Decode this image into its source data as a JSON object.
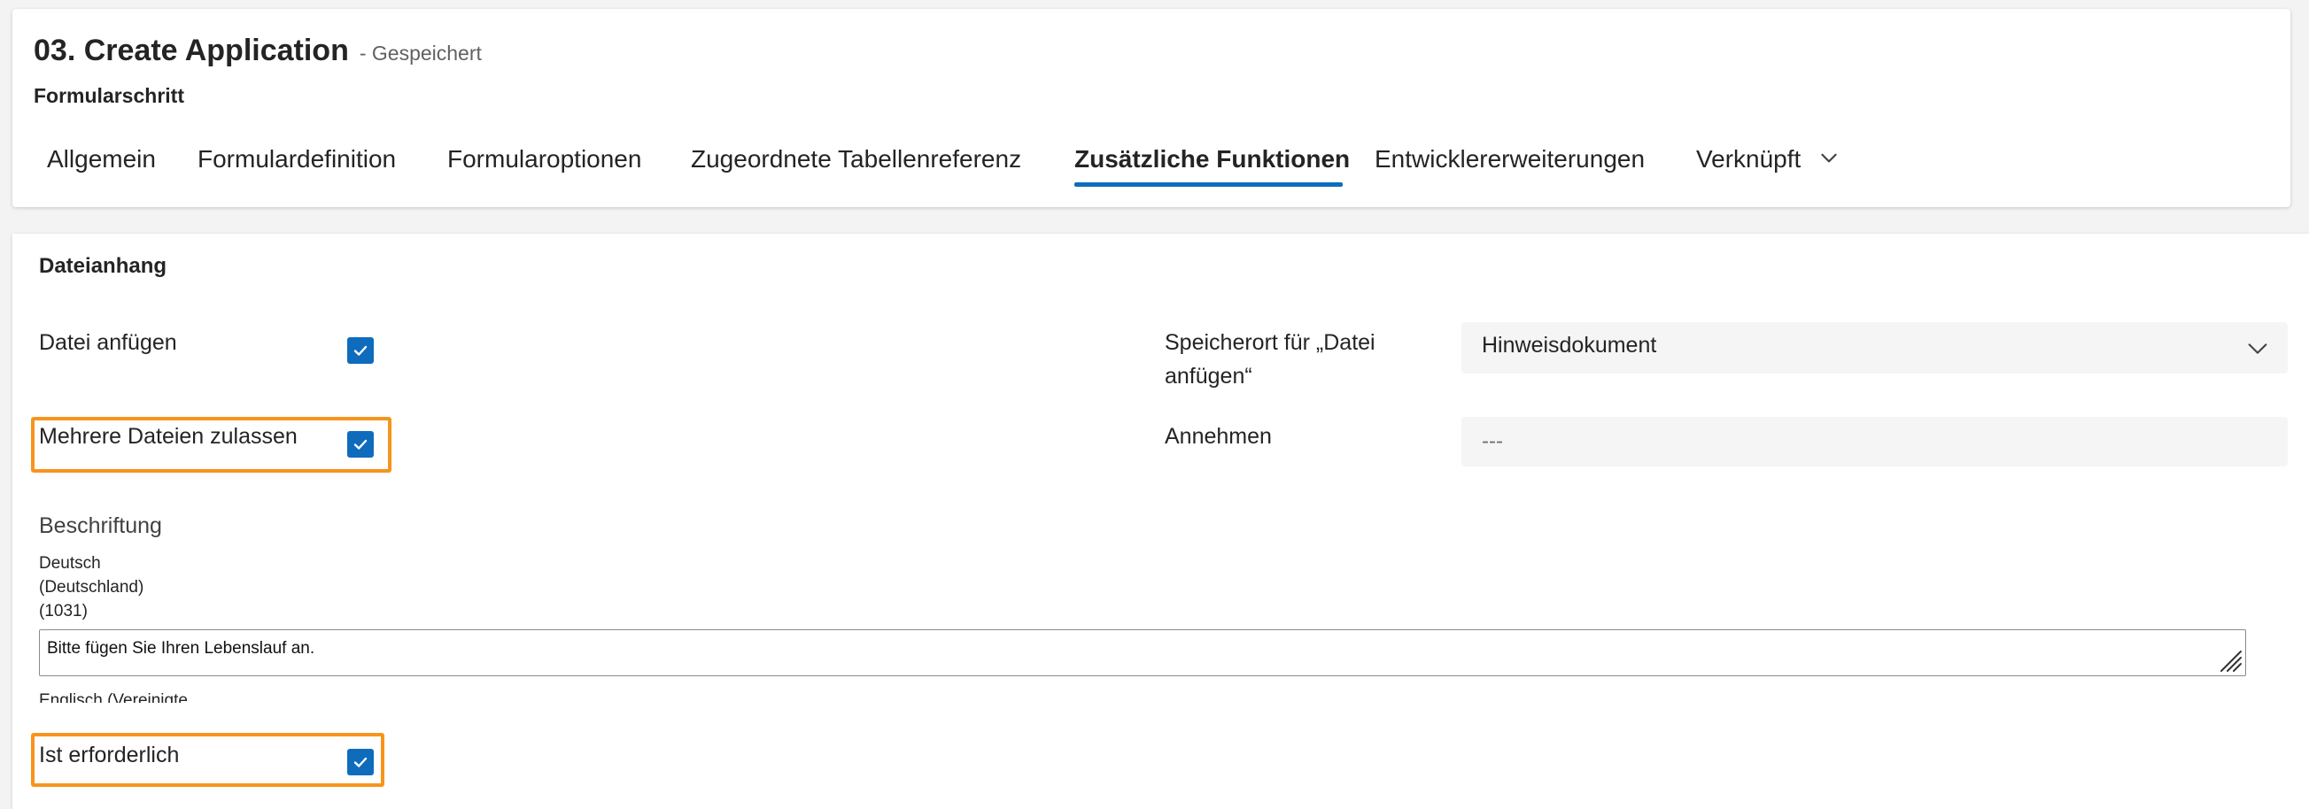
{
  "header": {
    "title": "03. Create Application",
    "save_status": "- Gespeichert",
    "entity": "Formularschritt"
  },
  "tabs": [
    {
      "label": "Allgemein",
      "active": false
    },
    {
      "label": "Formulardefinition",
      "active": false
    },
    {
      "label": "Formularoptionen",
      "active": false
    },
    {
      "label": "Zugeordnete Tabellenreferenz",
      "active": false
    },
    {
      "label": "Zusätzliche Funktionen",
      "active": true
    },
    {
      "label": "Entwicklererweiterungen",
      "active": false
    },
    {
      "label": "Verknüpft",
      "active": false,
      "icon": "chevron-down-icon"
    }
  ],
  "section": {
    "title": "Dateianhang",
    "attach_file": {
      "label": "Datei anfügen",
      "checked": true
    },
    "allow_multiple": {
      "label": "Mehrere Dateien zulassen",
      "checked": true,
      "highlighted": true
    },
    "storage_location": {
      "label_line1": "Speicherort für „Datei",
      "label_line2": "anfügen“",
      "value": "Hinweisdokument",
      "icon": "chevron-down-icon"
    },
    "accept": {
      "label": "Annehmen",
      "value": "---"
    },
    "caption": {
      "label": "Beschriftung",
      "lang1_line1": "Deutsch",
      "lang1_line2": "(Deutschland)",
      "lang1_line3": "(1031)",
      "lang1_value": "Bitte fügen Sie Ihren Lebenslauf an.",
      "lang2_partial": "Englisch (Vereinigte"
    },
    "required": {
      "label": "Ist erforderlich",
      "checked": true,
      "highlighted": true
    }
  },
  "colors": {
    "accent": "#0f6cbd",
    "highlight": "#f7941d"
  }
}
